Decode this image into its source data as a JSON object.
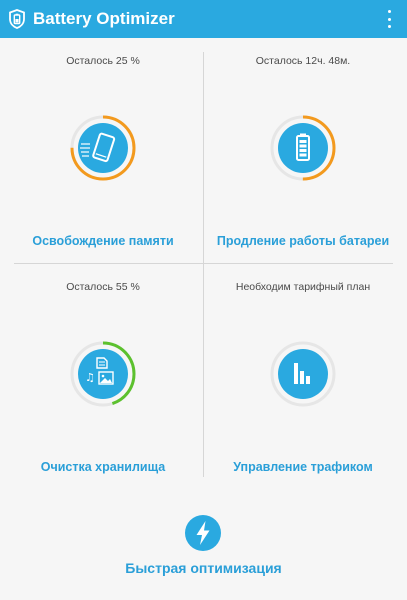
{
  "app": {
    "title": "Battery Optimizer",
    "icon": "battery-shield-icon",
    "menu_icon": "more-vert-icon"
  },
  "colors": {
    "accent": "#2aa9e0",
    "label": "#2a9fd8",
    "progress_orange": "#f39a1e",
    "progress_green": "#5cc12e",
    "ring_track": "#e6e6e6"
  },
  "tiles": [
    {
      "status": "Осталось 25 %",
      "label": "Освобождение памяти",
      "icon": "phone-boost-icon",
      "progress": 0.75,
      "progress_color": "orange"
    },
    {
      "status": "Осталось 12ч. 48м.",
      "label": "Продление работы батареи",
      "icon": "battery-icon",
      "progress": 0.5,
      "progress_color": "orange"
    },
    {
      "status": "Осталось 55 %",
      "label": "Очистка хранилища",
      "icon": "media-files-icon",
      "progress": 0.45,
      "progress_color": "green"
    },
    {
      "status": "Необходим тарифный план",
      "label": "Управление трафиком",
      "icon": "bar-chart-icon",
      "progress": 0,
      "progress_color": "none"
    }
  ],
  "quick_action": {
    "label": "Быстрая оптимизация",
    "icon": "lightning-icon"
  }
}
